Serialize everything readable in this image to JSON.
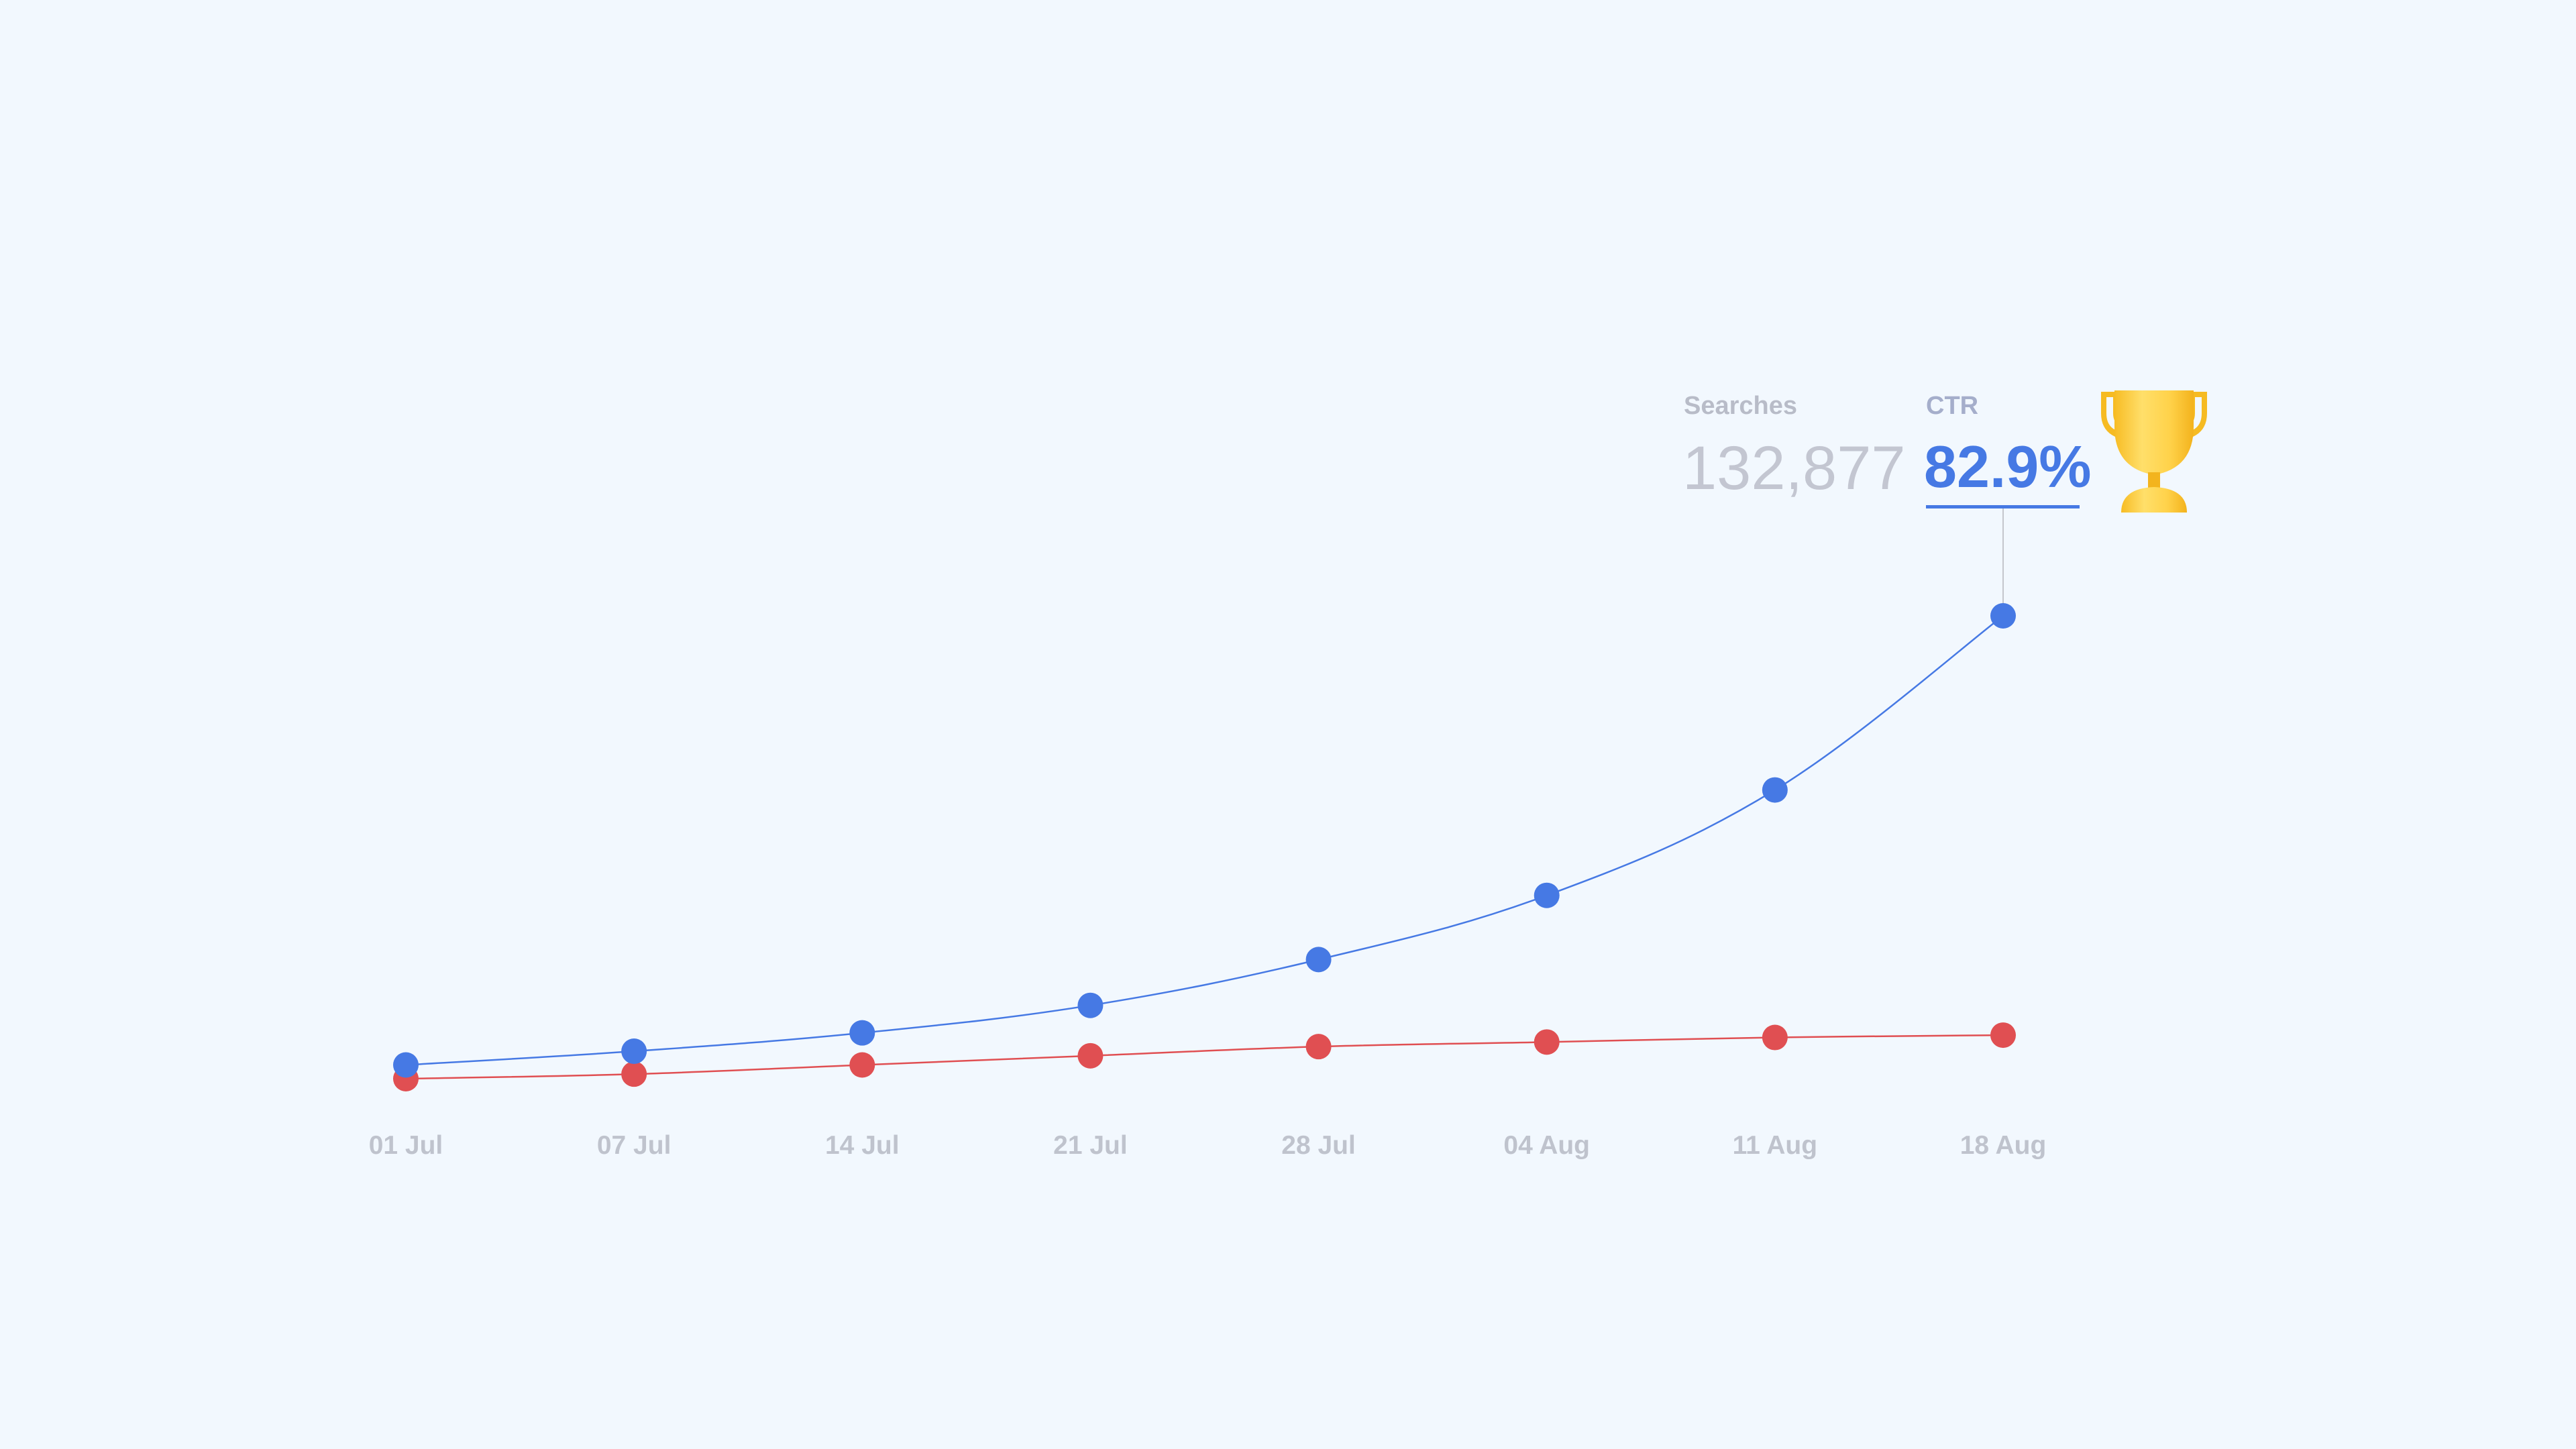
{
  "colors": {
    "background": "#f2f8fe",
    "ctr": "#4679e4",
    "searches": "#e04f52",
    "leader": "#c4c6cc",
    "trophy_light": "#ffd95a",
    "trophy_dark": "#f6b91f"
  },
  "stats": {
    "searches_label": "Searches",
    "searches_value": "132,877",
    "ctr_label": "CTR",
    "ctr_value": "82.9%"
  },
  "icon": "trophy-icon",
  "chart_data": {
    "type": "line",
    "categories": [
      "01 Jul",
      "07 Jul",
      "14 Jul",
      "21 Jul",
      "28 Jul",
      "04 Aug",
      "11 Aug",
      "18 Aug"
    ],
    "series": [
      {
        "name": "CTR",
        "color": "#4679e4",
        "values": [
          2,
          5,
          9,
          15,
          25,
          39,
          62,
          100
        ]
      },
      {
        "name": "Searches",
        "color": "#e04f52",
        "values": [
          -1,
          0,
          2,
          4,
          6,
          7,
          8,
          8.5
        ]
      }
    ],
    "ylim": [
      -1,
      100
    ],
    "grid": false,
    "legend": "none",
    "highlight_index": 7,
    "xlabel": "",
    "ylabel": ""
  }
}
